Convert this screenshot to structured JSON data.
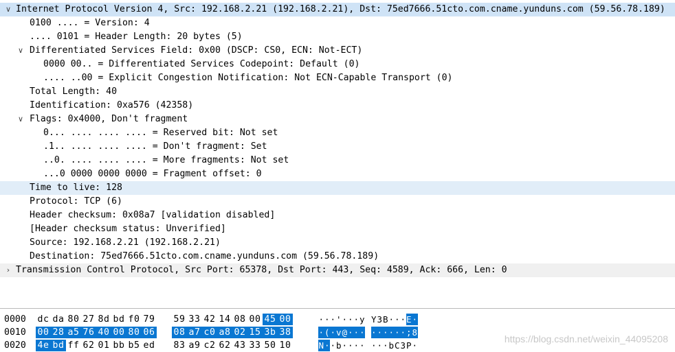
{
  "tree": [
    {
      "text": "Internet Protocol Version 4, Src: 192.168.2.21 (192.168.2.21), Dst: 75ed7666.51cto.com.cname.yunduns.com (59.56.78.189)",
      "indent": 0,
      "arrow": "expanded",
      "bg": "sel-dark"
    },
    {
      "text": "0100 .... = Version: 4",
      "indent": 1,
      "arrow": "none",
      "bg": ""
    },
    {
      "text": ".... 0101 = Header Length: 20 bytes (5)",
      "indent": 1,
      "arrow": "none",
      "bg": ""
    },
    {
      "text": "Differentiated Services Field: 0x00 (DSCP: CS0, ECN: Not-ECT)",
      "indent": 1,
      "arrow": "expanded",
      "bg": ""
    },
    {
      "text": "0000 00.. = Differentiated Services Codepoint: Default (0)",
      "indent": 2,
      "arrow": "none",
      "bg": ""
    },
    {
      "text": ".... ..00 = Explicit Congestion Notification: Not ECN-Capable Transport (0)",
      "indent": 2,
      "arrow": "none",
      "bg": ""
    },
    {
      "text": "Total Length: 40",
      "indent": 1,
      "arrow": "none",
      "bg": ""
    },
    {
      "text": "Identification: 0xa576 (42358)",
      "indent": 1,
      "arrow": "none",
      "bg": ""
    },
    {
      "text": "Flags: 0x4000, Don't fragment",
      "indent": 1,
      "arrow": "expanded",
      "bg": ""
    },
    {
      "text": "0... .... .... .... = Reserved bit: Not set",
      "indent": 2,
      "arrow": "none",
      "bg": ""
    },
    {
      "text": ".1.. .... .... .... = Don't fragment: Set",
      "indent": 2,
      "arrow": "none",
      "bg": ""
    },
    {
      "text": "..0. .... .... .... = More fragments: Not set",
      "indent": 2,
      "arrow": "none",
      "bg": ""
    },
    {
      "text": "...0 0000 0000 0000 = Fragment offset: 0",
      "indent": 2,
      "arrow": "none",
      "bg": ""
    },
    {
      "text": "Time to live: 128",
      "indent": 1,
      "arrow": "none",
      "bg": "sel-light"
    },
    {
      "text": "Protocol: TCP (6)",
      "indent": 1,
      "arrow": "none",
      "bg": ""
    },
    {
      "text": "Header checksum: 0x08a7 [validation disabled]",
      "indent": 1,
      "arrow": "none",
      "bg": ""
    },
    {
      "text": "[Header checksum status: Unverified]",
      "indent": 1,
      "arrow": "none",
      "bg": ""
    },
    {
      "text": "Source: 192.168.2.21 (192.168.2.21)",
      "indent": 1,
      "arrow": "none",
      "bg": ""
    },
    {
      "text": "Destination: 75ed7666.51cto.com.cname.yunduns.com (59.56.78.189)",
      "indent": 1,
      "arrow": "none",
      "bg": ""
    },
    {
      "text": "Transmission Control Protocol, Src Port: 65378, Dst Port: 443, Seq: 4589, Ack: 666, Len: 0",
      "indent": 0,
      "arrow": "collapsed",
      "bg": "gray"
    }
  ],
  "arrows": {
    "expanded": "∨",
    "collapsed": "›"
  },
  "hex_dump": [
    {
      "offset": "0000",
      "bytes": [
        "dc",
        "da",
        "80",
        "27",
        "8d",
        "bd",
        "f0",
        "79",
        "59",
        "33",
        "42",
        "14",
        "08",
        "00",
        "45",
        "00"
      ],
      "ascii": [
        "·",
        "·",
        "·",
        "'",
        "·",
        "·",
        "·",
        "y",
        "Y",
        "3",
        "B",
        "·",
        "·",
        "·",
        "E",
        "·"
      ],
      "hl": [
        14,
        15
      ]
    },
    {
      "offset": "0010",
      "bytes": [
        "00",
        "28",
        "a5",
        "76",
        "40",
        "00",
        "80",
        "06",
        "08",
        "a7",
        "c0",
        "a8",
        "02",
        "15",
        "3b",
        "38"
      ],
      "ascii": [
        "·",
        "(",
        "·",
        "v",
        "@",
        "·",
        "·",
        "·",
        "·",
        "·",
        "·",
        "·",
        "·",
        "·",
        ";",
        "8"
      ],
      "hl": [
        0,
        1,
        2,
        3,
        4,
        5,
        6,
        7,
        8,
        9,
        10,
        11,
        12,
        13,
        14,
        15
      ]
    },
    {
      "offset": "0020",
      "bytes": [
        "4e",
        "bd",
        "ff",
        "62",
        "01",
        "bb",
        "b5",
        "ed",
        "83",
        "a9",
        "c2",
        "62",
        "43",
        "33",
        "50",
        "10"
      ],
      "ascii": [
        "N",
        "·",
        "·",
        "b",
        "·",
        "·",
        "·",
        "·",
        "·",
        "·",
        "·",
        "b",
        "C",
        "3",
        "P",
        "·"
      ],
      "hl": [
        0,
        1
      ]
    }
  ],
  "watermark": "https://blog.csdn.net/weixin_44095208",
  "colors": {
    "selection_dark": "#cfe3f6",
    "selection_light": "#e1edf8",
    "highlight": "#0a77d2"
  }
}
